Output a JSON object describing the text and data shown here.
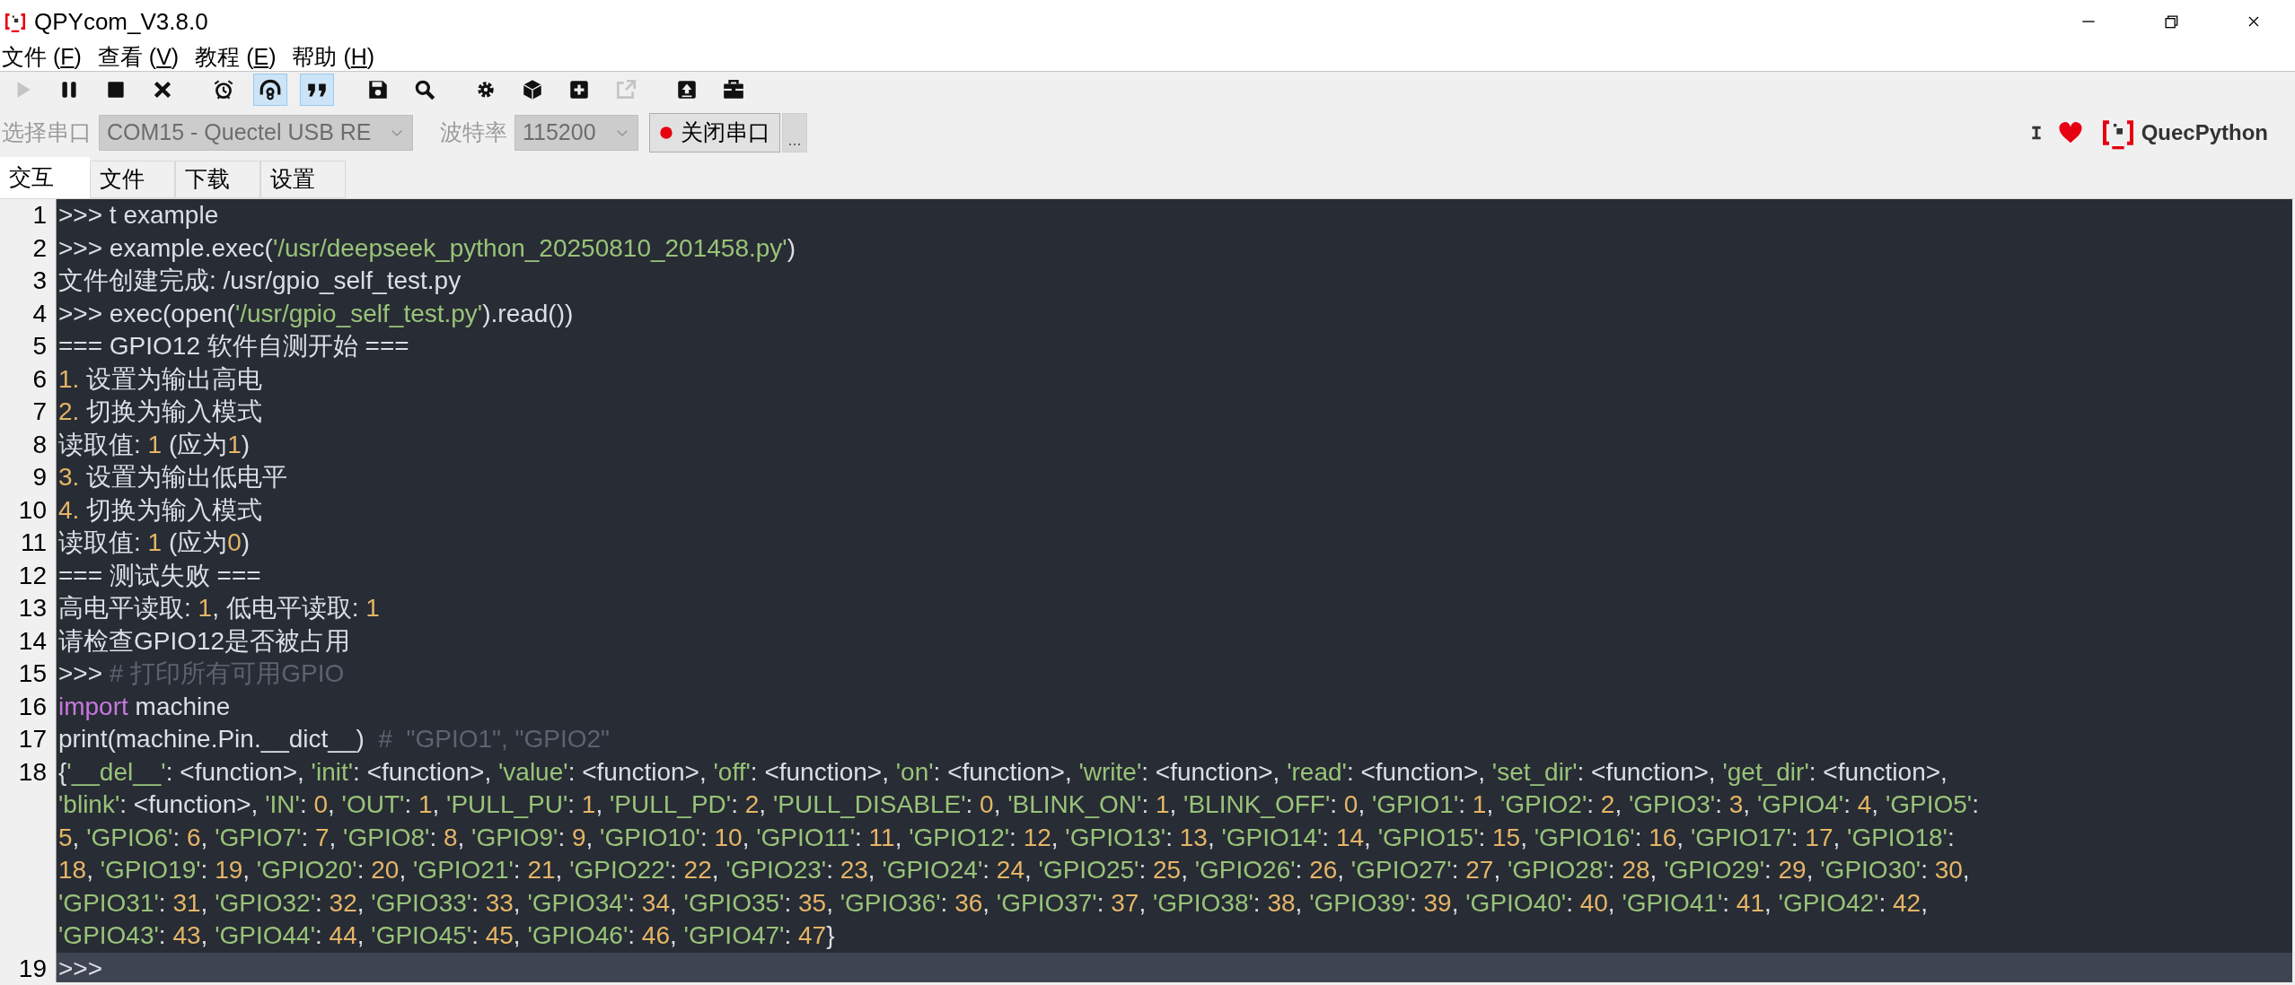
{
  "window": {
    "title": "QPYcom_V3.8.0"
  },
  "menu": [
    {
      "before": "文件 (",
      "access_key": "F",
      "after": ")"
    },
    {
      "before": "查看 (",
      "access_key": "V",
      "after": ")"
    },
    {
      "before": "教程 (",
      "access_key": "E",
      "after": ")"
    },
    {
      "before": "帮助 (",
      "access_key": "H",
      "after": ")"
    }
  ],
  "toolbar": [
    {
      "selected": false,
      "disabled": true
    },
    {
      "selected": false,
      "disabled": false
    },
    {
      "selected": false,
      "disabled": false
    },
    {
      "selected": false,
      "disabled": false
    },
    {
      "selected": false,
      "disabled": false
    },
    {
      "selected": true,
      "disabled": false
    },
    {
      "selected": true,
      "disabled": false
    },
    {
      "selected": false,
      "disabled": false
    },
    {
      "selected": false,
      "disabled": false
    },
    {
      "selected": false,
      "disabled": false
    },
    {
      "selected": false,
      "disabled": false
    },
    {
      "selected": false,
      "disabled": false
    },
    {
      "selected": false,
      "disabled": true
    },
    {
      "selected": false,
      "disabled": false
    },
    {
      "selected": false,
      "disabled": false
    }
  ],
  "port_bar": {
    "port_label": "选择串口",
    "port_value": "COM15 - Quectel USB RE",
    "baud_label": "波特率",
    "baud_value": "115200",
    "disabled": true,
    "connect_button": "关闭串口",
    "more_button": "...",
    "brand": "QuecPython"
  },
  "tabs": [
    {
      "label": "交互",
      "selected": true
    },
    {
      "label": "文件",
      "selected": false
    },
    {
      "label": "下载",
      "selected": false
    },
    {
      "label": "设置",
      "selected": false
    }
  ],
  "editor": {
    "lines": [
      {
        "number": "1",
        "current": false,
        "rows": [
          {
            "tokens": [
              {
                "kind": "plain",
                "text": ">>> t example"
              }
            ]
          }
        ]
      },
      {
        "number": "2",
        "current": false,
        "rows": [
          {
            "tokens": [
              {
                "kind": "plain",
                "text": ">>> example.exec("
              },
              {
                "kind": "string",
                "text": "'/usr/deepseek_python_20250810_201458.py'"
              },
              {
                "kind": "plain",
                "text": ")"
              }
            ]
          }
        ]
      },
      {
        "number": "3",
        "current": false,
        "rows": [
          {
            "tokens": [
              {
                "kind": "plain",
                "text": "文件创建完成: /usr/gpio_self_test.py"
              }
            ]
          }
        ]
      },
      {
        "number": "4",
        "current": false,
        "rows": [
          {
            "tokens": [
              {
                "kind": "plain",
                "text": ">>> exec(open("
              },
              {
                "kind": "string",
                "text": "'/usr/gpio_self_test.py'"
              },
              {
                "kind": "plain",
                "text": ").read())"
              }
            ]
          }
        ]
      },
      {
        "number": "5",
        "current": false,
        "rows": [
          {
            "tokens": [
              {
                "kind": "plain",
                "text": "=== GPIO12 软件自测开始 ==="
              }
            ]
          }
        ]
      },
      {
        "number": "6",
        "current": false,
        "rows": [
          {
            "tokens": [
              {
                "kind": "number",
                "text": "1."
              },
              {
                "kind": "plain",
                "text": " 设置为输出高电"
              }
            ]
          }
        ]
      },
      {
        "number": "7",
        "current": false,
        "rows": [
          {
            "tokens": [
              {
                "kind": "number",
                "text": "2."
              },
              {
                "kind": "plain",
                "text": " 切换为输入模式"
              }
            ]
          }
        ]
      },
      {
        "number": "8",
        "current": false,
        "rows": [
          {
            "tokens": [
              {
                "kind": "plain",
                "text": "读取值: "
              },
              {
                "kind": "number",
                "text": "1"
              },
              {
                "kind": "plain",
                "text": " (应为"
              },
              {
                "kind": "number",
                "text": "1"
              },
              {
                "kind": "plain",
                "text": ")"
              }
            ]
          }
        ]
      },
      {
        "number": "9",
        "current": false,
        "rows": [
          {
            "tokens": [
              {
                "kind": "number",
                "text": "3."
              },
              {
                "kind": "plain",
                "text": " 设置为输出低电平"
              }
            ]
          }
        ]
      },
      {
        "number": "10",
        "current": false,
        "rows": [
          {
            "tokens": [
              {
                "kind": "number",
                "text": "4."
              },
              {
                "kind": "plain",
                "text": " 切换为输入模式"
              }
            ]
          }
        ]
      },
      {
        "number": "11",
        "current": false,
        "rows": [
          {
            "tokens": [
              {
                "kind": "plain",
                "text": "读取值: "
              },
              {
                "kind": "number",
                "text": "1"
              },
              {
                "kind": "plain",
                "text": " (应为"
              },
              {
                "kind": "number",
                "text": "0"
              },
              {
                "kind": "plain",
                "text": ")"
              }
            ]
          }
        ]
      },
      {
        "number": "12",
        "current": false,
        "rows": [
          {
            "tokens": [
              {
                "kind": "plain",
                "text": "=== 测试失败 ==="
              }
            ]
          }
        ]
      },
      {
        "number": "13",
        "current": false,
        "rows": [
          {
            "tokens": [
              {
                "kind": "plain",
                "text": "高电平读取: "
              },
              {
                "kind": "number",
                "text": "1"
              },
              {
                "kind": "plain",
                "text": ", 低电平读取: "
              },
              {
                "kind": "number",
                "text": "1"
              }
            ]
          }
        ]
      },
      {
        "number": "14",
        "current": false,
        "rows": [
          {
            "tokens": [
              {
                "kind": "plain",
                "text": "请检查GPIO12是否被占用"
              }
            ]
          }
        ]
      },
      {
        "number": "15",
        "current": false,
        "rows": [
          {
            "tokens": [
              {
                "kind": "plain",
                "text": ">>> "
              },
              {
                "kind": "comment",
                "text": "# 打印所有可用GPIO"
              }
            ]
          }
        ]
      },
      {
        "number": "16",
        "current": false,
        "rows": [
          {
            "tokens": [
              {
                "kind": "keyword",
                "text": "import"
              },
              {
                "kind": "plain",
                "text": " machine"
              }
            ]
          }
        ]
      },
      {
        "number": "17",
        "current": false,
        "rows": [
          {
            "tokens": [
              {
                "kind": "plain",
                "text": "print(machine.Pin.__dict__)  "
              },
              {
                "kind": "comment",
                "text": "#  \"GPIO1\", \"GPIO2\""
              }
            ]
          }
        ]
      },
      {
        "number": "18",
        "current": false,
        "rows": [
          {
            "tokens": [
              {
                "kind": "plain",
                "text": "{"
              },
              {
                "kind": "string",
                "text": "'__del__'"
              },
              {
                "kind": "plain",
                "text": ": <function>, "
              },
              {
                "kind": "string",
                "text": "'init'"
              },
              {
                "kind": "plain",
                "text": ": <function>, "
              },
              {
                "kind": "string",
                "text": "'value'"
              },
              {
                "kind": "plain",
                "text": ": <function>, "
              },
              {
                "kind": "string",
                "text": "'off'"
              },
              {
                "kind": "plain",
                "text": ": <function>, "
              },
              {
                "kind": "string",
                "text": "'on'"
              },
              {
                "kind": "plain",
                "text": ": <function>, "
              },
              {
                "kind": "string",
                "text": "'write'"
              },
              {
                "kind": "plain",
                "text": ": <function>, "
              },
              {
                "kind": "string",
                "text": "'read'"
              },
              {
                "kind": "plain",
                "text": ": <function>, "
              },
              {
                "kind": "string",
                "text": "'set_dir'"
              },
              {
                "kind": "plain",
                "text": ": <function>, "
              },
              {
                "kind": "string",
                "text": "'get_dir'"
              },
              {
                "kind": "plain",
                "text": ": <function>,"
              }
            ]
          },
          {
            "tokens": [
              {
                "kind": "string",
                "text": "'blink'"
              },
              {
                "kind": "plain",
                "text": ": <function>, "
              },
              {
                "kind": "string",
                "text": "'IN'"
              },
              {
                "kind": "plain",
                "text": ": "
              },
              {
                "kind": "number",
                "text": "0"
              },
              {
                "kind": "plain",
                "text": ", "
              },
              {
                "kind": "string",
                "text": "'OUT'"
              },
              {
                "kind": "plain",
                "text": ": "
              },
              {
                "kind": "number",
                "text": "1"
              },
              {
                "kind": "plain",
                "text": ", "
              },
              {
                "kind": "string",
                "text": "'PULL_PU'"
              },
              {
                "kind": "plain",
                "text": ": "
              },
              {
                "kind": "number",
                "text": "1"
              },
              {
                "kind": "plain",
                "text": ", "
              },
              {
                "kind": "string",
                "text": "'PULL_PD'"
              },
              {
                "kind": "plain",
                "text": ": "
              },
              {
                "kind": "number",
                "text": "2"
              },
              {
                "kind": "plain",
                "text": ", "
              },
              {
                "kind": "string",
                "text": "'PULL_DISABLE'"
              },
              {
                "kind": "plain",
                "text": ": "
              },
              {
                "kind": "number",
                "text": "0"
              },
              {
                "kind": "plain",
                "text": ", "
              },
              {
                "kind": "string",
                "text": "'BLINK_ON'"
              },
              {
                "kind": "plain",
                "text": ": "
              },
              {
                "kind": "number",
                "text": "1"
              },
              {
                "kind": "plain",
                "text": ", "
              },
              {
                "kind": "string",
                "text": "'BLINK_OFF'"
              },
              {
                "kind": "plain",
                "text": ": "
              },
              {
                "kind": "number",
                "text": "0"
              },
              {
                "kind": "plain",
                "text": ", "
              },
              {
                "kind": "string",
                "text": "'GPIO1'"
              },
              {
                "kind": "plain",
                "text": ": "
              },
              {
                "kind": "number",
                "text": "1"
              },
              {
                "kind": "plain",
                "text": ", "
              },
              {
                "kind": "string",
                "text": "'GPIO2'"
              },
              {
                "kind": "plain",
                "text": ": "
              },
              {
                "kind": "number",
                "text": "2"
              },
              {
                "kind": "plain",
                "text": ", "
              },
              {
                "kind": "string",
                "text": "'GPIO3'"
              },
              {
                "kind": "plain",
                "text": ": "
              },
              {
                "kind": "number",
                "text": "3"
              },
              {
                "kind": "plain",
                "text": ", "
              },
              {
                "kind": "string",
                "text": "'GPIO4'"
              },
              {
                "kind": "plain",
                "text": ": "
              },
              {
                "kind": "number",
                "text": "4"
              },
              {
                "kind": "plain",
                "text": ", "
              },
              {
                "kind": "string",
                "text": "'GPIO5'"
              },
              {
                "kind": "plain",
                "text": ":"
              }
            ]
          },
          {
            "tokens": [
              {
                "kind": "number",
                "text": "5"
              },
              {
                "kind": "plain",
                "text": ", "
              },
              {
                "kind": "string",
                "text": "'GPIO6'"
              },
              {
                "kind": "plain",
                "text": ": "
              },
              {
                "kind": "number",
                "text": "6"
              },
              {
                "kind": "plain",
                "text": ", "
              },
              {
                "kind": "string",
                "text": "'GPIO7'"
              },
              {
                "kind": "plain",
                "text": ": "
              },
              {
                "kind": "number",
                "text": "7"
              },
              {
                "kind": "plain",
                "text": ", "
              },
              {
                "kind": "string",
                "text": "'GPIO8'"
              },
              {
                "kind": "plain",
                "text": ": "
              },
              {
                "kind": "number",
                "text": "8"
              },
              {
                "kind": "plain",
                "text": ", "
              },
              {
                "kind": "string",
                "text": "'GPIO9'"
              },
              {
                "kind": "plain",
                "text": ": "
              },
              {
                "kind": "number",
                "text": "9"
              },
              {
                "kind": "plain",
                "text": ", "
              },
              {
                "kind": "string",
                "text": "'GPIO10'"
              },
              {
                "kind": "plain",
                "text": ": "
              },
              {
                "kind": "number",
                "text": "10"
              },
              {
                "kind": "plain",
                "text": ", "
              },
              {
                "kind": "string",
                "text": "'GPIO11'"
              },
              {
                "kind": "plain",
                "text": ": "
              },
              {
                "kind": "number",
                "text": "11"
              },
              {
                "kind": "plain",
                "text": ", "
              },
              {
                "kind": "string",
                "text": "'GPIO12'"
              },
              {
                "kind": "plain",
                "text": ": "
              },
              {
                "kind": "number",
                "text": "12"
              },
              {
                "kind": "plain",
                "text": ", "
              },
              {
                "kind": "string",
                "text": "'GPIO13'"
              },
              {
                "kind": "plain",
                "text": ": "
              },
              {
                "kind": "number",
                "text": "13"
              },
              {
                "kind": "plain",
                "text": ", "
              },
              {
                "kind": "string",
                "text": "'GPIO14'"
              },
              {
                "kind": "plain",
                "text": ": "
              },
              {
                "kind": "number",
                "text": "14"
              },
              {
                "kind": "plain",
                "text": ", "
              },
              {
                "kind": "string",
                "text": "'GPIO15'"
              },
              {
                "kind": "plain",
                "text": ": "
              },
              {
                "kind": "number",
                "text": "15"
              },
              {
                "kind": "plain",
                "text": ", "
              },
              {
                "kind": "string",
                "text": "'GPIO16'"
              },
              {
                "kind": "plain",
                "text": ": "
              },
              {
                "kind": "number",
                "text": "16"
              },
              {
                "kind": "plain",
                "text": ", "
              },
              {
                "kind": "string",
                "text": "'GPIO17'"
              },
              {
                "kind": "plain",
                "text": ": "
              },
              {
                "kind": "number",
                "text": "17"
              },
              {
                "kind": "plain",
                "text": ", "
              },
              {
                "kind": "string",
                "text": "'GPIO18'"
              },
              {
                "kind": "plain",
                "text": ":"
              }
            ]
          },
          {
            "tokens": [
              {
                "kind": "number",
                "text": "18"
              },
              {
                "kind": "plain",
                "text": ", "
              },
              {
                "kind": "string",
                "text": "'GPIO19'"
              },
              {
                "kind": "plain",
                "text": ": "
              },
              {
                "kind": "number",
                "text": "19"
              },
              {
                "kind": "plain",
                "text": ", "
              },
              {
                "kind": "string",
                "text": "'GPIO20'"
              },
              {
                "kind": "plain",
                "text": ": "
              },
              {
                "kind": "number",
                "text": "20"
              },
              {
                "kind": "plain",
                "text": ", "
              },
              {
                "kind": "string",
                "text": "'GPIO21'"
              },
              {
                "kind": "plain",
                "text": ": "
              },
              {
                "kind": "number",
                "text": "21"
              },
              {
                "kind": "plain",
                "text": ", "
              },
              {
                "kind": "string",
                "text": "'GPIO22'"
              },
              {
                "kind": "plain",
                "text": ": "
              },
              {
                "kind": "number",
                "text": "22"
              },
              {
                "kind": "plain",
                "text": ", "
              },
              {
                "kind": "string",
                "text": "'GPIO23'"
              },
              {
                "kind": "plain",
                "text": ": "
              },
              {
                "kind": "number",
                "text": "23"
              },
              {
                "kind": "plain",
                "text": ", "
              },
              {
                "kind": "string",
                "text": "'GPIO24'"
              },
              {
                "kind": "plain",
                "text": ": "
              },
              {
                "kind": "number",
                "text": "24"
              },
              {
                "kind": "plain",
                "text": ", "
              },
              {
                "kind": "string",
                "text": "'GPIO25'"
              },
              {
                "kind": "plain",
                "text": ": "
              },
              {
                "kind": "number",
                "text": "25"
              },
              {
                "kind": "plain",
                "text": ", "
              },
              {
                "kind": "string",
                "text": "'GPIO26'"
              },
              {
                "kind": "plain",
                "text": ": "
              },
              {
                "kind": "number",
                "text": "26"
              },
              {
                "kind": "plain",
                "text": ", "
              },
              {
                "kind": "string",
                "text": "'GPIO27'"
              },
              {
                "kind": "plain",
                "text": ": "
              },
              {
                "kind": "number",
                "text": "27"
              },
              {
                "kind": "plain",
                "text": ", "
              },
              {
                "kind": "string",
                "text": "'GPIO28'"
              },
              {
                "kind": "plain",
                "text": ": "
              },
              {
                "kind": "number",
                "text": "28"
              },
              {
                "kind": "plain",
                "text": ", "
              },
              {
                "kind": "string",
                "text": "'GPIO29'"
              },
              {
                "kind": "plain",
                "text": ": "
              },
              {
                "kind": "number",
                "text": "29"
              },
              {
                "kind": "plain",
                "text": ", "
              },
              {
                "kind": "string",
                "text": "'GPIO30'"
              },
              {
                "kind": "plain",
                "text": ": "
              },
              {
                "kind": "number",
                "text": "30"
              },
              {
                "kind": "plain",
                "text": ","
              }
            ]
          },
          {
            "tokens": [
              {
                "kind": "string",
                "text": "'GPIO31'"
              },
              {
                "kind": "plain",
                "text": ": "
              },
              {
                "kind": "number",
                "text": "31"
              },
              {
                "kind": "plain",
                "text": ", "
              },
              {
                "kind": "string",
                "text": "'GPIO32'"
              },
              {
                "kind": "plain",
                "text": ": "
              },
              {
                "kind": "number",
                "text": "32"
              },
              {
                "kind": "plain",
                "text": ", "
              },
              {
                "kind": "string",
                "text": "'GPIO33'"
              },
              {
                "kind": "plain",
                "text": ": "
              },
              {
                "kind": "number",
                "text": "33"
              },
              {
                "kind": "plain",
                "text": ", "
              },
              {
                "kind": "string",
                "text": "'GPIO34'"
              },
              {
                "kind": "plain",
                "text": ": "
              },
              {
                "kind": "number",
                "text": "34"
              },
              {
                "kind": "plain",
                "text": ", "
              },
              {
                "kind": "string",
                "text": "'GPIO35'"
              },
              {
                "kind": "plain",
                "text": ": "
              },
              {
                "kind": "number",
                "text": "35"
              },
              {
                "kind": "plain",
                "text": ", "
              },
              {
                "kind": "string",
                "text": "'GPIO36'"
              },
              {
                "kind": "plain",
                "text": ": "
              },
              {
                "kind": "number",
                "text": "36"
              },
              {
                "kind": "plain",
                "text": ", "
              },
              {
                "kind": "string",
                "text": "'GPIO37'"
              },
              {
                "kind": "plain",
                "text": ": "
              },
              {
                "kind": "number",
                "text": "37"
              },
              {
                "kind": "plain",
                "text": ", "
              },
              {
                "kind": "string",
                "text": "'GPIO38'"
              },
              {
                "kind": "plain",
                "text": ": "
              },
              {
                "kind": "number",
                "text": "38"
              },
              {
                "kind": "plain",
                "text": ", "
              },
              {
                "kind": "string",
                "text": "'GPIO39'"
              },
              {
                "kind": "plain",
                "text": ": "
              },
              {
                "kind": "number",
                "text": "39"
              },
              {
                "kind": "plain",
                "text": ", "
              },
              {
                "kind": "string",
                "text": "'GPIO40'"
              },
              {
                "kind": "plain",
                "text": ": "
              },
              {
                "kind": "number",
                "text": "40"
              },
              {
                "kind": "plain",
                "text": ", "
              },
              {
                "kind": "string",
                "text": "'GPIO41'"
              },
              {
                "kind": "plain",
                "text": ": "
              },
              {
                "kind": "number",
                "text": "41"
              },
              {
                "kind": "plain",
                "text": ", "
              },
              {
                "kind": "string",
                "text": "'GPIO42'"
              },
              {
                "kind": "plain",
                "text": ": "
              },
              {
                "kind": "number",
                "text": "42"
              },
              {
                "kind": "plain",
                "text": ","
              }
            ]
          },
          {
            "tokens": [
              {
                "kind": "string",
                "text": "'GPIO43'"
              },
              {
                "kind": "plain",
                "text": ": "
              },
              {
                "kind": "number",
                "text": "43"
              },
              {
                "kind": "plain",
                "text": ", "
              },
              {
                "kind": "string",
                "text": "'GPIO44'"
              },
              {
                "kind": "plain",
                "text": ": "
              },
              {
                "kind": "number",
                "text": "44"
              },
              {
                "kind": "plain",
                "text": ", "
              },
              {
                "kind": "string",
                "text": "'GPIO45'"
              },
              {
                "kind": "plain",
                "text": ": "
              },
              {
                "kind": "number",
                "text": "45"
              },
              {
                "kind": "plain",
                "text": ", "
              },
              {
                "kind": "string",
                "text": "'GPIO46'"
              },
              {
                "kind": "plain",
                "text": ": "
              },
              {
                "kind": "number",
                "text": "46"
              },
              {
                "kind": "plain",
                "text": ", "
              },
              {
                "kind": "string",
                "text": "'GPIO47'"
              },
              {
                "kind": "plain",
                "text": ": "
              },
              {
                "kind": "number",
                "text": "47"
              },
              {
                "kind": "plain",
                "text": "}"
              }
            ]
          }
        ]
      },
      {
        "number": "19",
        "current": true,
        "rows": [
          {
            "tokens": [
              {
                "kind": "plain",
                "text": ">>>"
              }
            ]
          }
        ]
      }
    ]
  }
}
